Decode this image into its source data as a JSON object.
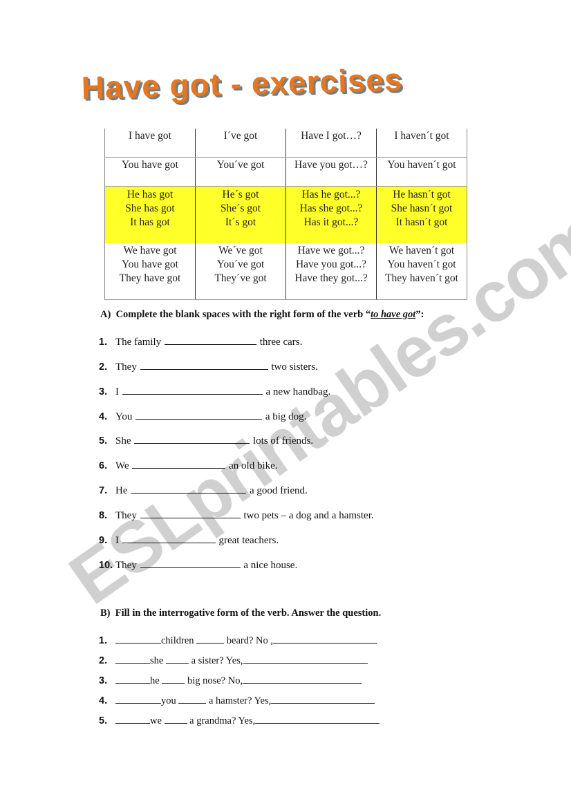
{
  "title": "Have got - exercises",
  "watermark": "ESLprintables.com",
  "highlight_color": "#ffff2a",
  "title_color": "#e8761e",
  "table": {
    "rows": [
      [
        [
          "I have got"
        ],
        [
          "I´ve got"
        ],
        [
          "Have I got…?"
        ],
        [
          "I haven´t got"
        ]
      ],
      [
        [
          "You have got"
        ],
        [
          "You´ve got"
        ],
        [
          "Have you got…?"
        ],
        [
          "You haven´t got"
        ]
      ],
      [
        [
          "He has got",
          "She has got",
          "It has got"
        ],
        [
          "He´s got",
          "She´s got",
          "It´s got"
        ],
        [
          "Has he got...?",
          "Has she got...?",
          "Has it got...?"
        ],
        [
          "He hasn´t got",
          "She hasn´t got",
          "It hasn´t got"
        ]
      ],
      [
        [
          "We have got",
          "You have got",
          "They have got"
        ],
        [
          "We´ve got",
          "You´ve got",
          "They´ve got"
        ],
        [
          "Have we got...?",
          "Have you got...?",
          "Have they got...?"
        ],
        [
          "We haven´t got",
          "You haven´t got",
          "They haven´t got"
        ]
      ]
    ]
  },
  "section_a": {
    "label": "A)",
    "instruction_prefix": "Complete the blank spaces with the right form of the verb “",
    "verb": "to have got",
    "instruction_suffix": "”:",
    "items": [
      {
        "num": "1.",
        "subject": "The family",
        "rest": "three cars."
      },
      {
        "num": "2.",
        "subject": "They",
        "rest": "two sisters."
      },
      {
        "num": "3.",
        "subject": "I",
        "rest": "a new handbag."
      },
      {
        "num": "4.",
        "subject": "You",
        "rest": "a big dog."
      },
      {
        "num": "5.",
        "subject": "She",
        "rest": "lots of friends."
      },
      {
        "num": "6.",
        "subject": "We",
        "rest": "an old bike."
      },
      {
        "num": "7.",
        "subject": "He",
        "rest": "a good friend."
      },
      {
        "num": "8.",
        "subject": "They",
        "rest": "two pets – a dog and a hamster."
      },
      {
        "num": "9.",
        "subject": "I",
        "rest": "great teachers."
      },
      {
        "num": "10.",
        "subject": "They",
        "rest": "a nice house."
      }
    ]
  },
  "section_b": {
    "label": "B)",
    "instruction": "Fill in the interrogative form of the verb. Answer the question.",
    "items": [
      {
        "num": "1.",
        "subject": "children",
        "object": "beard? No ,"
      },
      {
        "num": "2.",
        "subject": "she",
        "object": "a sister? Yes,"
      },
      {
        "num": "3.",
        "subject": "he",
        "object": "big nose? No,"
      },
      {
        "num": "4.",
        "subject": "you",
        "object": "a hamster? Yes,"
      },
      {
        "num": "5.",
        "subject": "we",
        "object": "a grandma? Yes,"
      }
    ]
  }
}
